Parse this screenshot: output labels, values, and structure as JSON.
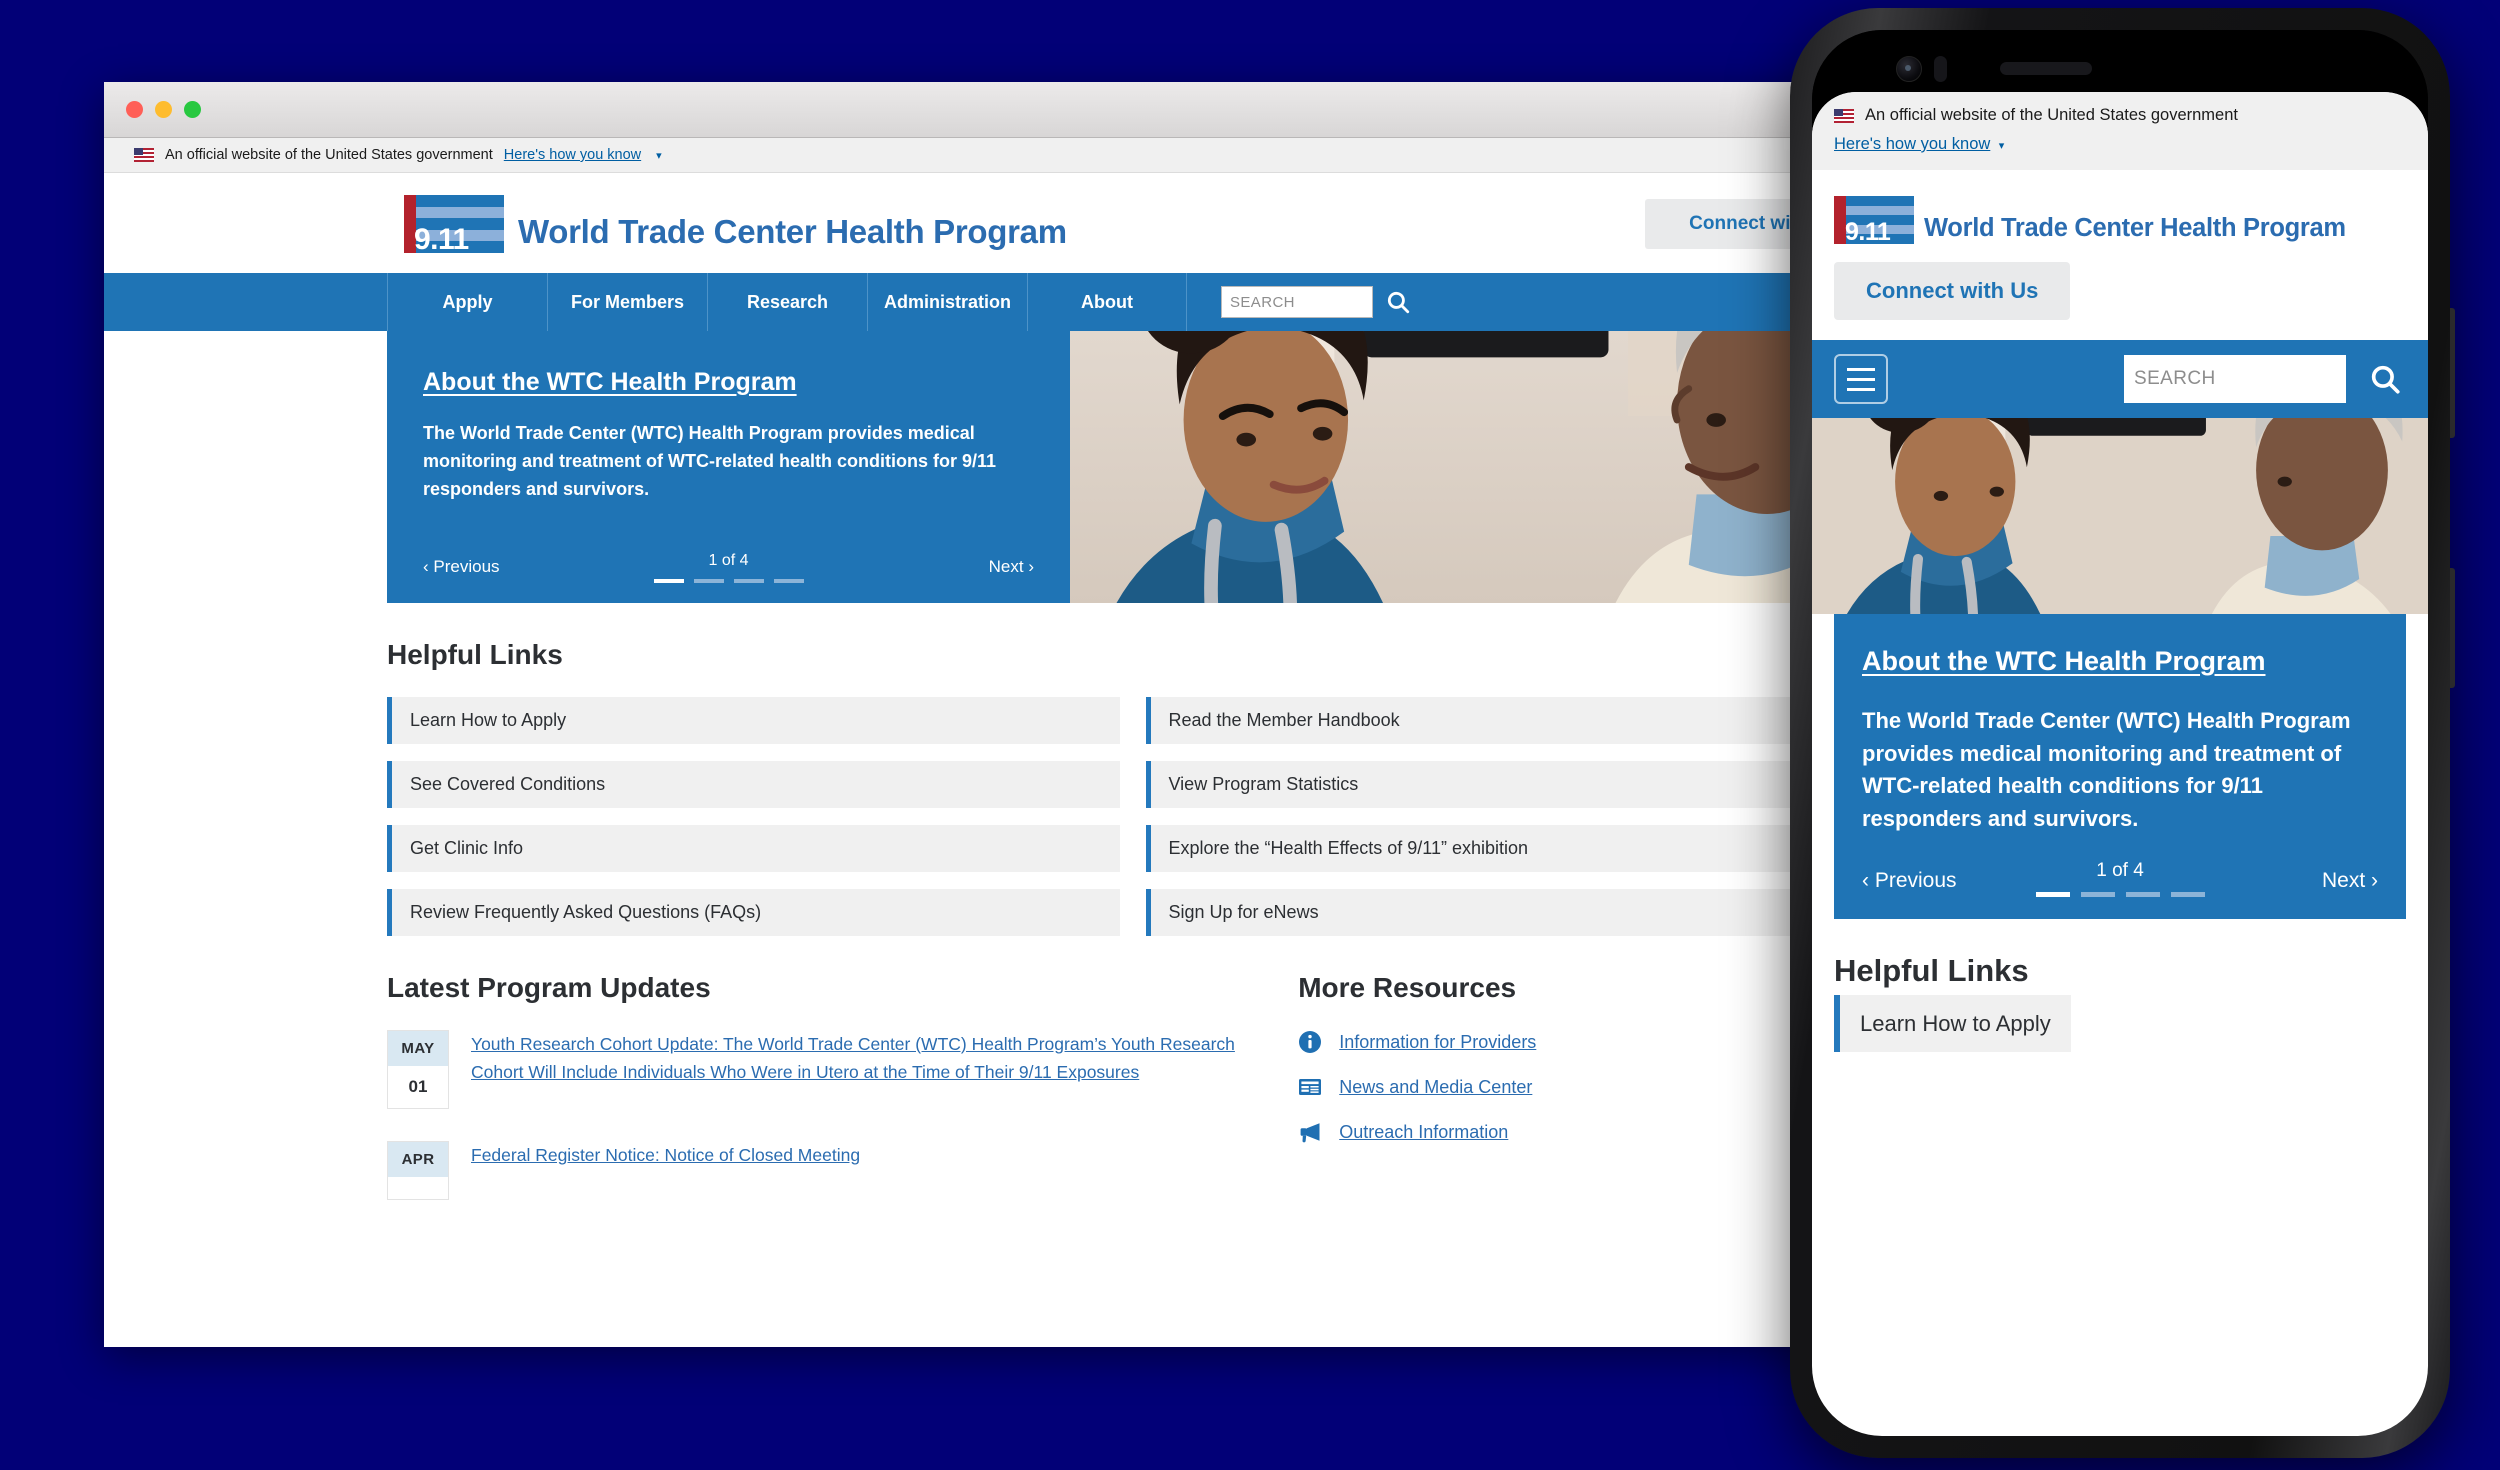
{
  "theme": {
    "desktop_background": "#020077",
    "brand_blue": "#1f74b5",
    "link_blue": "#2b6cb0",
    "accent_bar": "#2479bd",
    "light_gray_box": "#f0f0f0",
    "date_badge_blue": "#d9e8f2"
  },
  "gov_banner": {
    "text": "An official website of the United States government",
    "link": "Here's how you know",
    "chevron": "⌄"
  },
  "header": {
    "logo_number": "9.11",
    "site_title": "World Trade Center Health Program",
    "connect_label": "Connect with Us"
  },
  "nav": {
    "items": [
      {
        "label": "Apply"
      },
      {
        "label": "For Members"
      },
      {
        "label": "Research"
      },
      {
        "label": "Administration"
      },
      {
        "label": "About"
      }
    ],
    "search_placeholder": "SEARCH",
    "search_value": "",
    "search_icon": "search-icon",
    "menu_icon": "hamburger-menu-icon"
  },
  "hero": {
    "title": "About the WTC Health Program",
    "body": "The World Trade Center (WTC) Health Program provides medical monitoring and treatment of WTC-related health conditions for 9/11 responders and survivors.",
    "previous": "‹ Previous",
    "next": "Next ›",
    "counter": "1 of 4",
    "total_slides": 4,
    "active_slide": 1,
    "image_alt": "Nurse in blue scrubs speaking with an older male patient"
  },
  "helpful_links": {
    "title": "Helpful Links",
    "items_left": [
      {
        "label": "Learn How to Apply"
      },
      {
        "label": "See Covered Conditions"
      },
      {
        "label": "Get Clinic Info"
      },
      {
        "label": "Review Frequently Asked Questions (FAQs)"
      }
    ],
    "items_right": [
      {
        "label": "Read the Member Handbook"
      },
      {
        "label": "View Program Statistics"
      },
      {
        "label": "Explore the “Health Effects of 9/11” exhibition"
      },
      {
        "label": "Sign Up for eNews"
      }
    ]
  },
  "updates": {
    "title": "Latest Program Updates",
    "items": [
      {
        "month": "MAY",
        "day": "01",
        "headline": "Youth Research Cohort Update: The World Trade Center (WTC) Health Program’s Youth Research Cohort Will Include Individuals Who Were in Utero at the Time of Their 9/11 Exposures"
      },
      {
        "month": "APR",
        "day": "",
        "headline": "Federal Register Notice: Notice of Closed Meeting"
      }
    ]
  },
  "resources": {
    "title": "More Resources",
    "items": [
      {
        "label": "Information for Providers",
        "icon": "info-circle-icon"
      },
      {
        "label": "News and Media Center",
        "icon": "newspaper-icon"
      },
      {
        "label": "Outreach Information",
        "icon": "megaphone-icon"
      }
    ]
  },
  "mobile": {
    "helpful_links_title": "Helpful Links",
    "first_link": "Learn How to Apply"
  }
}
